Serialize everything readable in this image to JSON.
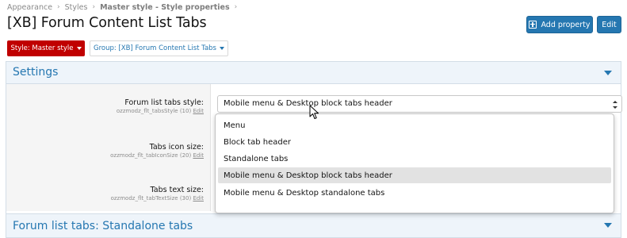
{
  "breadcrumb": {
    "items": [
      "Appearance",
      "Styles",
      "Master style - Style properties"
    ]
  },
  "page": {
    "title": "[XB] Forum Content List Tabs"
  },
  "actions": {
    "add_property": "Add property",
    "edit": "Edit"
  },
  "filters": {
    "style": "Style: Master style",
    "group": "Group: [XB] Forum Content List Tabs"
  },
  "settings": {
    "title": "Settings",
    "rows": [
      {
        "label": "Forum list tabs style:",
        "hint": "ozzmodz_flt_tabsStyle (10)",
        "edit": "Edit"
      },
      {
        "label": "Tabs icon size:",
        "hint": "ozzmodz_flt_tabIconSize (20)",
        "edit": "Edit"
      },
      {
        "label": "Tabs text size:",
        "hint": "ozzmodz_flt_tabTextSize (30)",
        "edit": "Edit"
      }
    ],
    "select_value": "Mobile menu & Desktop block tabs header"
  },
  "dropdown": {
    "options": [
      "Menu",
      "Block tab header",
      "Standalone tabs",
      "Mobile menu & Desktop block tabs header",
      "Mobile menu & Desktop standalone tabs"
    ],
    "highlighted_index": 3
  },
  "section2": {
    "title": "Forum list tabs: Standalone tabs"
  },
  "colors": {
    "accent": "#2577b1",
    "style_button": "#c00000",
    "header_bg": "#eef4fa"
  }
}
